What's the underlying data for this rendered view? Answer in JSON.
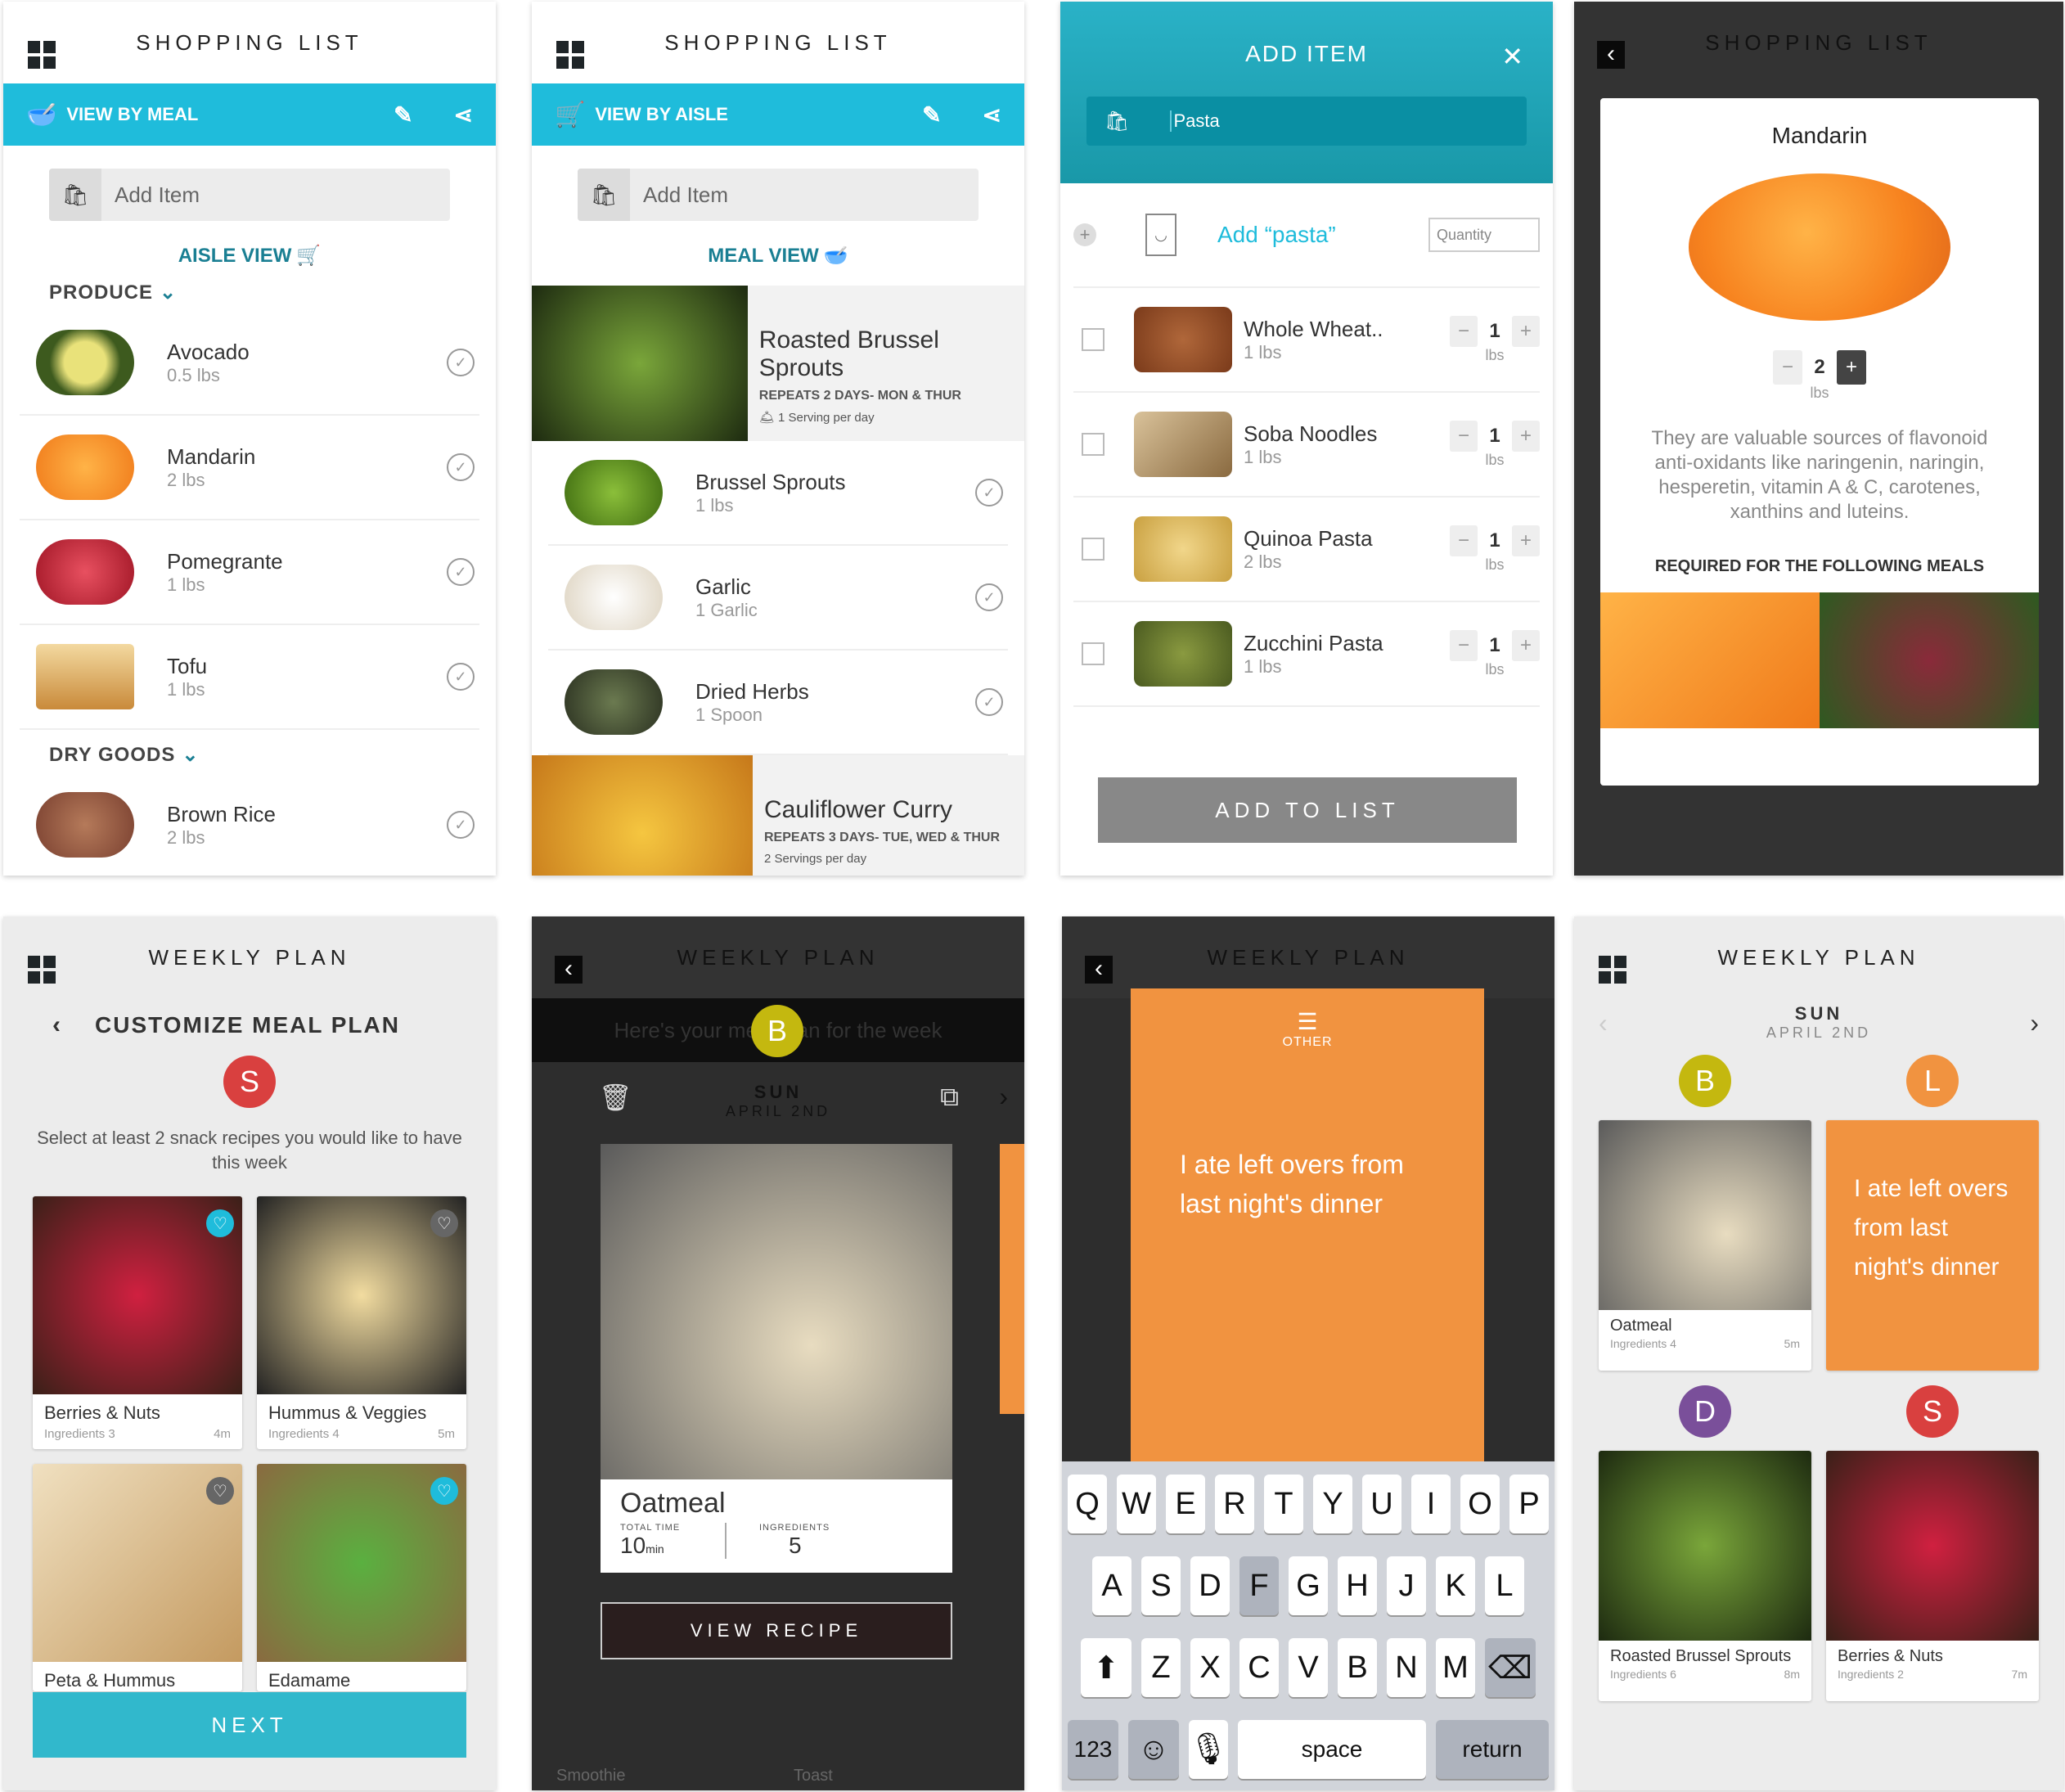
{
  "colors": {
    "accent": "#1fbcdb",
    "orange": "#f19340",
    "breakfast": "#c4b80f",
    "lunch": "#f19340",
    "dinner": "#7a4f9a",
    "snack": "#d9403f"
  },
  "p1": {
    "title": "SHOPPING LIST",
    "bar_label": "VIEW BY MEAL",
    "add_placeholder": "Add Item",
    "toggle": "AISLE VIEW",
    "sections": [
      {
        "name": "PRODUCE",
        "items": [
          {
            "name": "Avocado",
            "qty": "0.5 lbs"
          },
          {
            "name": "Mandarin",
            "qty": "2 lbs"
          },
          {
            "name": "Pomegrante",
            "qty": "1 lbs"
          },
          {
            "name": "Tofu",
            "qty": "1 lbs"
          }
        ]
      },
      {
        "name": "DRY GOODS",
        "items": [
          {
            "name": "Brown Rice",
            "qty": "2 lbs"
          }
        ]
      }
    ]
  },
  "p2": {
    "title": "SHOPPING LIST",
    "bar_label": "VIEW BY AISLE",
    "add_placeholder": "Add Item",
    "toggle": "MEAL VIEW",
    "meals": [
      {
        "name": "Roasted Brussel Sprouts",
        "repeats": "REPEATS 2 DAYS- MON & THUR",
        "servings": "1 Serving per day",
        "items": [
          {
            "name": "Brussel Sprouts",
            "qty": "1 lbs"
          },
          {
            "name": "Garlic",
            "qty": "1 Garlic"
          },
          {
            "name": "Dried Herbs",
            "qty": "1 Spoon"
          }
        ]
      },
      {
        "name": "Cauliflower Curry",
        "repeats": "REPEATS 3 DAYS- TUE, WED & THUR",
        "servings": "2 Servings per day"
      }
    ]
  },
  "p3": {
    "title": "ADD ITEM",
    "input_value": "Pasta",
    "add_suggestion": "Add “pasta”",
    "quantity_placeholder": "Quantity",
    "items": [
      {
        "name": "Whole Wheat..",
        "qty": "1 lbs",
        "count": "1",
        "unit": "lbs"
      },
      {
        "name": "Soba Noodles",
        "qty": "1 lbs",
        "count": "1",
        "unit": "lbs"
      },
      {
        "name": "Quinoa Pasta",
        "qty": "2 lbs",
        "count": "1",
        "unit": "lbs"
      },
      {
        "name": "Zucchini Pasta",
        "qty": "1 lbs",
        "count": "1",
        "unit": "lbs"
      }
    ],
    "add_button": "ADD TO LIST"
  },
  "p4": {
    "title": "SHOPPING LIST",
    "item": "Mandarin",
    "count": "2",
    "unit": "lbs",
    "description": "They are valuable sources of flavonoid anti-oxidants like naringenin, naringin, hesperetin, vitamin A & C, carotenes, xanthins and luteins.",
    "required_label": "REQUIRED FOR THE FOLLOWING MEALS"
  },
  "p5": {
    "title": "WEEKLY PLAN",
    "subtitle": "CUSTOMIZE MEAL PLAN",
    "badge": "S",
    "instructions": "Select at least 2 snack recipes you would like to have this week",
    "snacks": [
      {
        "name": "Berries & Nuts",
        "ingredients": "Ingredients 3",
        "time": "4m"
      },
      {
        "name": "Hummus & Veggies",
        "ingredients": "Ingredients 4",
        "time": "5m"
      },
      {
        "name": "Peta & Hummus"
      },
      {
        "name": "Edamame"
      }
    ],
    "next": "NEXT"
  },
  "p6": {
    "title": "WEEKLY PLAN",
    "banner": "Here's your meal plan for the week",
    "badge": "B",
    "day": "SUN",
    "date": "APRIL 2ND",
    "recipe": {
      "name": "Oatmeal",
      "time_label": "TOTAL TIME",
      "time_value": "10",
      "time_unit": "min",
      "ingr_label": "INGREDIENTS",
      "ingr_value": "5"
    },
    "view_recipe": "VIEW RECIPE",
    "bg_items": [
      "Smoothie",
      "Toast"
    ]
  },
  "p7": {
    "title": "WEEKLY PLAN",
    "other_label": "OTHER",
    "note": "I ate left overs from last night's dinner",
    "keyboard": {
      "row1": [
        "Q",
        "W",
        "E",
        "R",
        "T",
        "Y",
        "U",
        "I",
        "O",
        "P"
      ],
      "row2": [
        "A",
        "S",
        "D",
        "F",
        "G",
        "H",
        "J",
        "K",
        "L"
      ],
      "row3": [
        "Z",
        "X",
        "C",
        "V",
        "B",
        "N",
        "M"
      ],
      "num": "123",
      "space": "space",
      "return": "return"
    }
  },
  "p8": {
    "title": "WEEKLY PLAN",
    "day": "SUN",
    "date": "APRIL 2ND",
    "meals": [
      {
        "badge": "B",
        "name": "Oatmeal",
        "ingredients": "Ingredients 4",
        "time": "5m"
      },
      {
        "badge": "L",
        "note": "I ate left overs from last night's dinner"
      },
      {
        "badge": "D",
        "name": "Roasted Brussel Sprouts",
        "ingredients": "Ingredients 6",
        "time": "8m"
      },
      {
        "badge": "S",
        "name": "Berries & Nuts",
        "ingredients": "Ingredients 2",
        "time": "7m"
      }
    ]
  }
}
